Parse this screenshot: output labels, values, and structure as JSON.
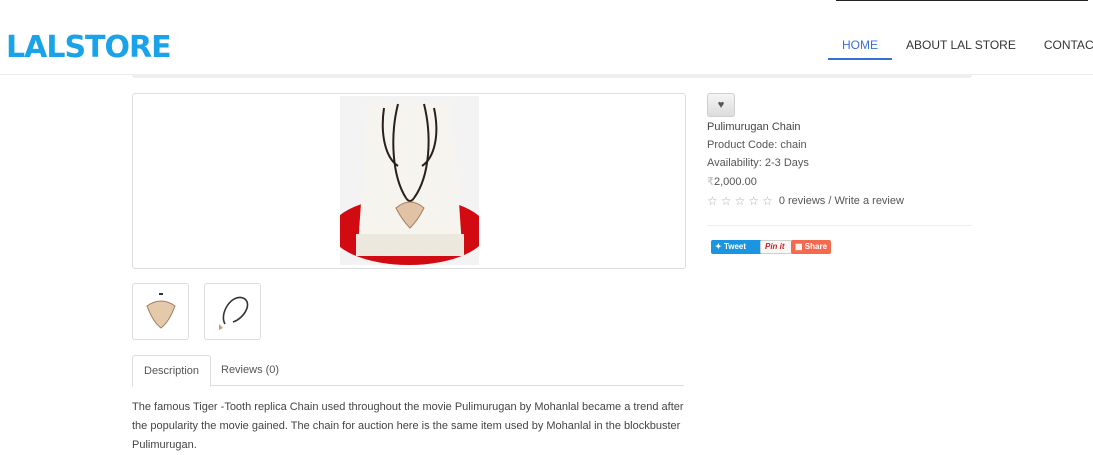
{
  "brand": {
    "logo_text": "LALSTORE",
    "accent": "#1aa3e8"
  },
  "nav": [
    {
      "label": "HOME",
      "active": true
    },
    {
      "label": "ABOUT LAL STORE",
      "active": false
    },
    {
      "label": "CONTACT",
      "active": false
    }
  ],
  "product": {
    "wishlist_icon": "heart-icon",
    "name": "Pulimurugan Chain",
    "code": "Product Code: chain",
    "availability": "Availability: 2-3 Days",
    "currency_glyph": "₹",
    "price": "2,000.00",
    "rating": {
      "stars_filled": 0,
      "stars_total": 5,
      "text": "0 reviews / Write a review"
    }
  },
  "share": {
    "tweet": "Tweet",
    "pinit": "Pin it",
    "share": "Share"
  },
  "tabs": [
    {
      "label": "Description",
      "active": true
    },
    {
      "label": "Reviews (0)",
      "active": false
    }
  ],
  "description": "The famous Tiger -Tooth replica Chain used throughout the movie Pulimurugan by Mohanlal became a trend after the popularity the movie gained. The chain for auction here is the same item used by Mohanlal in the blockbuster Pulimurugan."
}
